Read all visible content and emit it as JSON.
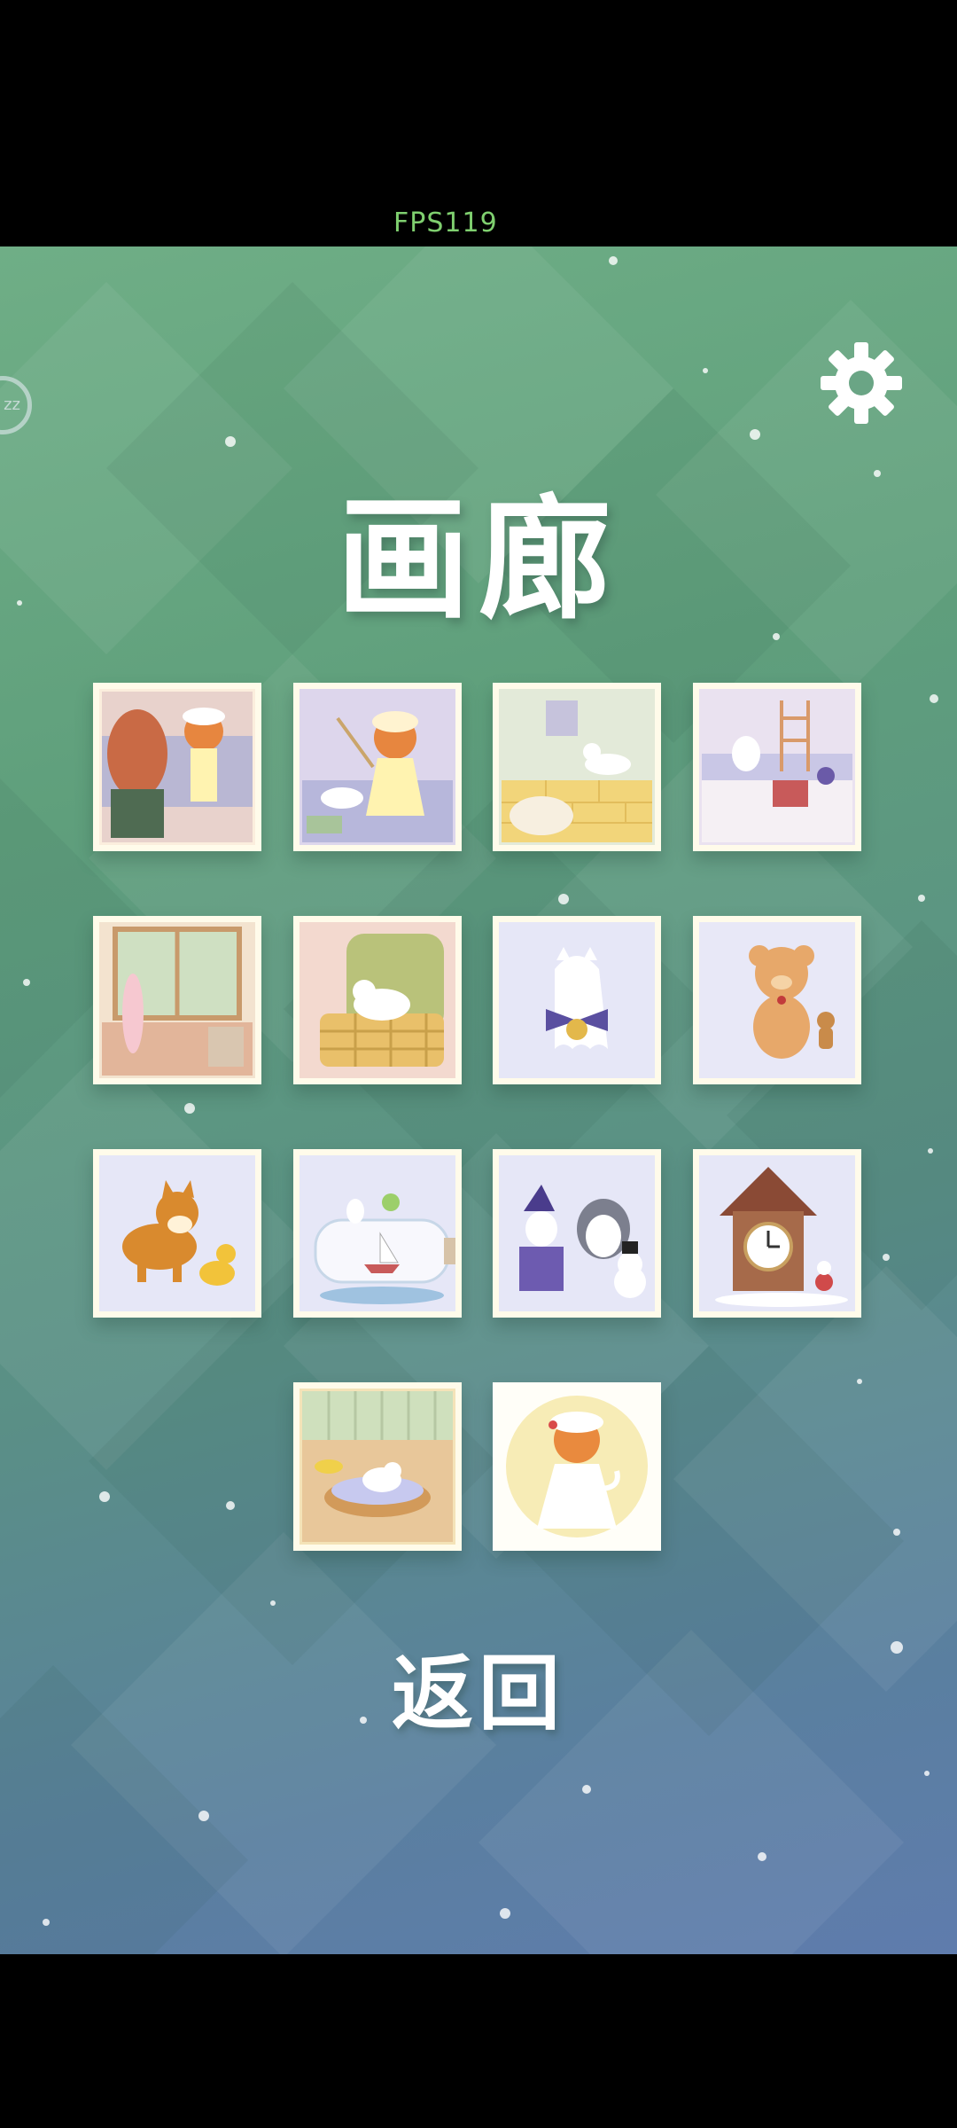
{
  "status": {
    "fps": "FPS119"
  },
  "gallery": {
    "title": "画廊",
    "back_label": "返回",
    "sleep_icon_text": "zz",
    "tiles": [
      {
        "name": "gallery-tile-girl-mirror"
      },
      {
        "name": "gallery-tile-girl-cat-cleaning"
      },
      {
        "name": "gallery-tile-cat-on-wall"
      },
      {
        "name": "gallery-tile-cats-attic"
      },
      {
        "name": "gallery-tile-cat-window"
      },
      {
        "name": "gallery-tile-cat-armchair"
      },
      {
        "name": "gallery-tile-ghost-cat-bell"
      },
      {
        "name": "gallery-tile-teddy-bear-gingerbread"
      },
      {
        "name": "gallery-tile-shiba-duck"
      },
      {
        "name": "gallery-tile-bottle-ship"
      },
      {
        "name": "gallery-tile-penguin-snowman"
      },
      {
        "name": "gallery-tile-cuckoo-clock"
      },
      {
        "name": "gallery-tile-cat-bed"
      },
      {
        "name": "gallery-tile-girl-white-dress"
      }
    ]
  },
  "colors": {
    "background_top": "#6fae86",
    "background_bottom": "#5f7cad",
    "fps_text": "#7fcf6f",
    "tile_frame": "#fffbea"
  }
}
